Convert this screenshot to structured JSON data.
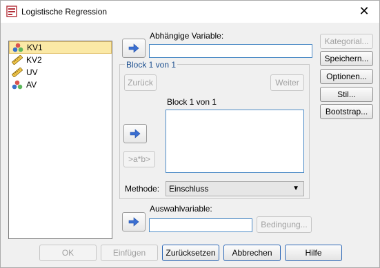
{
  "window": {
    "title": "Logistische Regression",
    "close_glyph": "✕"
  },
  "variables": [
    {
      "name": "KV1",
      "icon": "nominal-variable-icon",
      "selected": true
    },
    {
      "name": "KV2",
      "icon": "scale-variable-icon",
      "selected": false
    },
    {
      "name": "UV",
      "icon": "scale-variable-icon",
      "selected": false
    },
    {
      "name": "AV",
      "icon": "nominal-variable-icon",
      "selected": false
    }
  ],
  "dependent": {
    "label": "Abhängige Variable:",
    "value": ""
  },
  "block": {
    "group_title": "Block 1 von 1",
    "list_label": "Block 1 von 1",
    "back_label": "Zurück",
    "next_label": "Weiter",
    "interaction_label": ">a*b>"
  },
  "method": {
    "label": "Methode:",
    "value": "Einschluss"
  },
  "selection": {
    "label": "Auswahlvariable:",
    "value": "",
    "condition_label": "Bedingung..."
  },
  "side_buttons": {
    "categorical": "Kategorial...",
    "save": "Speichern...",
    "options": "Optionen...",
    "style": "Stil...",
    "bootstrap": "Bootstrap..."
  },
  "footer": {
    "ok": "OK",
    "paste": "Einfügen",
    "reset": "Zurücksetzen",
    "cancel": "Abbrechen",
    "help": "Hilfe"
  },
  "colors": {
    "accent": "#2a66b6",
    "arrow": "#3b6fd1",
    "selection": "#fbe9a6"
  }
}
